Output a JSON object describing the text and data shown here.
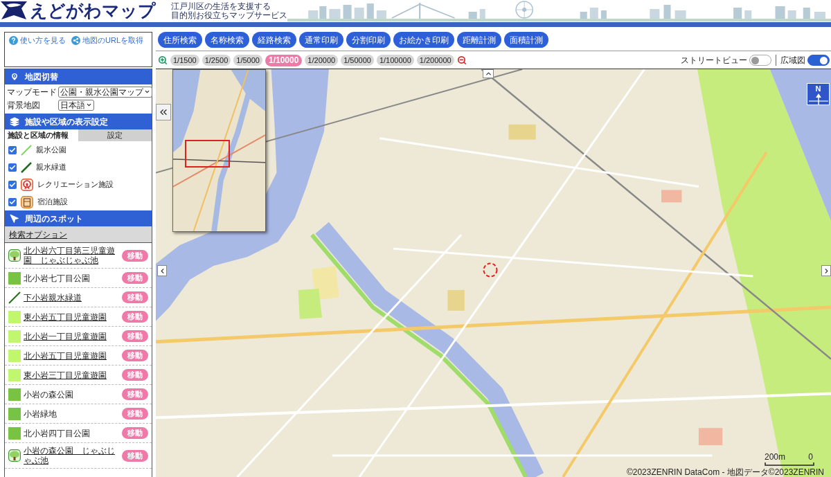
{
  "header": {
    "title": "えどがわマップ",
    "tagline": [
      "江戸川区の生活を支援する",
      "目的別お役立ちマップサービス"
    ]
  },
  "sidebar": {
    "links": [
      {
        "kind": "help",
        "label": "使い方を見る"
      },
      {
        "kind": "share",
        "label": "地図のURLを取得"
      }
    ],
    "map_switch": {
      "title": "地図切替",
      "fields": [
        {
          "label": "マップモード",
          "value": "公園・親水公園マップ"
        },
        {
          "label": "背景地図",
          "value": "日本語"
        }
      ]
    },
    "display_settings": {
      "title": "施設や区域の表示設定",
      "tabs": [
        {
          "label": "施設と区域の情報",
          "selected": true
        },
        {
          "label": "設定",
          "selected": false
        }
      ],
      "layers": [
        {
          "kind": "light-line",
          "label": "親水公園",
          "checked": true
        },
        {
          "kind": "dark-line",
          "label": "親水緑道",
          "checked": true
        },
        {
          "kind": "recreation",
          "label": "レクリエーション施設",
          "checked": true
        },
        {
          "kind": "lodging",
          "label": "宿泊施設",
          "checked": true
        }
      ]
    },
    "nearby_spots": {
      "title": "周辺のスポット",
      "search_options": "検索オプション",
      "spots": [
        {
          "kind": "tree",
          "name": "北小岩六丁目第三児童遊園　じゃぶじゃぶ池",
          "link": true,
          "button": "移動"
        },
        {
          "kind": "park",
          "name": "北小岩七丁目公園",
          "link": false,
          "button": "移動"
        },
        {
          "kind": "greenway",
          "name": "下小岩親水緑道",
          "link": true,
          "button": "移動"
        },
        {
          "kind": "playground",
          "name": "東小岩五丁目児童遊園",
          "link": true,
          "button": "移動"
        },
        {
          "kind": "playground",
          "name": "北小岩一丁目児童遊園",
          "link": true,
          "button": "移動"
        },
        {
          "kind": "playground",
          "name": "北小岩五丁目児童遊園",
          "link": true,
          "button": "移動"
        },
        {
          "kind": "playground",
          "name": "東小岩三丁目児童遊園",
          "link": true,
          "button": "移動"
        },
        {
          "kind": "park",
          "name": "小岩の森公園",
          "link": false,
          "button": "移動"
        },
        {
          "kind": "park",
          "name": "小岩緑地",
          "link": false,
          "button": "移動"
        },
        {
          "kind": "park",
          "name": "北小岩四丁目公園",
          "link": false,
          "button": "移動"
        },
        {
          "kind": "tree",
          "name": "小岩の森公園　じゃぶじゃぶ池",
          "link": true,
          "button": "移動"
        }
      ]
    }
  },
  "toolbar": {
    "buttons": [
      "住所検索",
      "名称検索",
      "経路検索",
      "通常印刷",
      "分割印刷",
      "お絵かき印刷",
      "距離計測",
      "面積計測"
    ]
  },
  "scales": [
    {
      "label": "1/1500",
      "selected": false
    },
    {
      "label": "1/2500",
      "selected": false
    },
    {
      "label": "1/5000",
      "selected": false
    },
    {
      "label": "1/10000",
      "selected": true
    },
    {
      "label": "1/20000",
      "selected": false
    },
    {
      "label": "1/50000",
      "selected": false
    },
    {
      "label": "1/100000",
      "selected": false
    },
    {
      "label": "1/200000",
      "selected": false
    }
  ],
  "street_view": {
    "label": "ストリートビュー",
    "on": false
  },
  "wide_area_map": {
    "label": "広域図",
    "on": true
  },
  "map": {
    "north": "N",
    "scale_label": "200m",
    "scale_zero": "0",
    "copyright": "©2023ZENRIN DataCom - 地図データ©2023ZENRIN"
  }
}
